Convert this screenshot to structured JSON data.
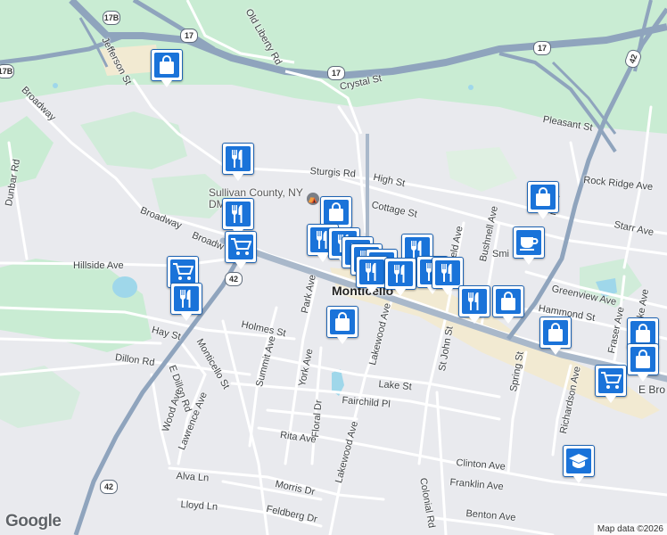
{
  "map": {
    "town_label": "Monticello",
    "poi_label": "Sullivan County, NY DMV",
    "streets": {
      "old_liberty": "Old Liberty Rd",
      "jefferson": "Jefferson St",
      "broadway_nw": "Broadway",
      "dunbar": "Dunbar Rd",
      "crystal": "Crystal St",
      "pleasant": "Pleasant St",
      "rock_ridge": "Rock Ridge Ave",
      "sturgis": "Sturgis Rd",
      "high": "High St",
      "cottage": "Cottage St",
      "starr": "Starr Ave",
      "broadway_w": "Broadway",
      "broadway_main": "Broadw",
      "hillside": "Hillside Ave",
      "bushnell": "Bushnell Ave",
      "field": "ield Ave",
      "smith": "Smi",
      "greenview": "Greenview Ave",
      "fiske": "Fiske Ave",
      "hammond": "Hammond St",
      "fraser": "Fraser Ave",
      "park": "Park Ave",
      "holmes": "Holmes St",
      "hay": "Hay St",
      "dillon": "Dillon Rd",
      "monticello_st": "Monticello St",
      "summit": "Summit Ave",
      "york": "York Ave",
      "lakewood_n": "Lakewood Ave",
      "st_john": "St John St",
      "spring": "Spring St",
      "e_broadway": "E Bro",
      "e_dillon": "E Dillon Rd",
      "wood": "Wood Ave",
      "lawrence": "Lawrence Ave",
      "lake": "Lake St",
      "fairchild": "Fairchild Pl",
      "floral": "Floral Dr",
      "richardson": "Richardson Ave",
      "rita": "Rita Ave",
      "lakewood_s": "Lakewood Ave",
      "clinton": "Clinton Ave",
      "franklin": "Franklin Ave",
      "alva": "Alva Ln",
      "morris": "Morris Dr",
      "colonial": "Colonial Rd",
      "lloyd": "Lloyd Ln",
      "feldberg": "Feldberg Dr",
      "benton": "Benton Ave",
      "nt_st": "nt St"
    },
    "route_shields": {
      "r17b_top": "17B",
      "r17b_left": "17B",
      "r17_a": "17",
      "r17_b": "17",
      "r17_c": "17",
      "r42_ne": "42",
      "r42_mid": "42",
      "r42_sw": "42"
    },
    "attribution": "Map data ©2026",
    "logo": "Google",
    "colors": {
      "background": "#e9eaee",
      "park": "#c9ecd3",
      "highway": "#8fa4bd",
      "water": "#9fd7ea",
      "commercial": "#f2ead2",
      "marker": "#1a73d9"
    }
  },
  "markers": [
    {
      "type": "shopping-bag"
    },
    {
      "type": "restaurant"
    },
    {
      "type": "restaurant"
    },
    {
      "type": "shopping-bag"
    },
    {
      "type": "shopping-cart"
    },
    {
      "type": "restaurant"
    },
    {
      "type": "restaurant"
    },
    {
      "type": "restaurant"
    },
    {
      "type": "restaurant"
    },
    {
      "type": "restaurant"
    },
    {
      "type": "restaurant"
    },
    {
      "type": "restaurant"
    },
    {
      "type": "restaurant"
    },
    {
      "type": "restaurant"
    },
    {
      "type": "restaurant"
    },
    {
      "type": "shopping-cart"
    },
    {
      "type": "restaurant"
    },
    {
      "type": "shopping-bag"
    },
    {
      "type": "restaurant"
    },
    {
      "type": "shopping-bag"
    },
    {
      "type": "shopping-bag"
    },
    {
      "type": "cafe"
    },
    {
      "type": "shopping-bag"
    },
    {
      "type": "shopping-bag"
    },
    {
      "type": "shopping-bag"
    },
    {
      "type": "shopping-cart"
    },
    {
      "type": "school"
    }
  ]
}
